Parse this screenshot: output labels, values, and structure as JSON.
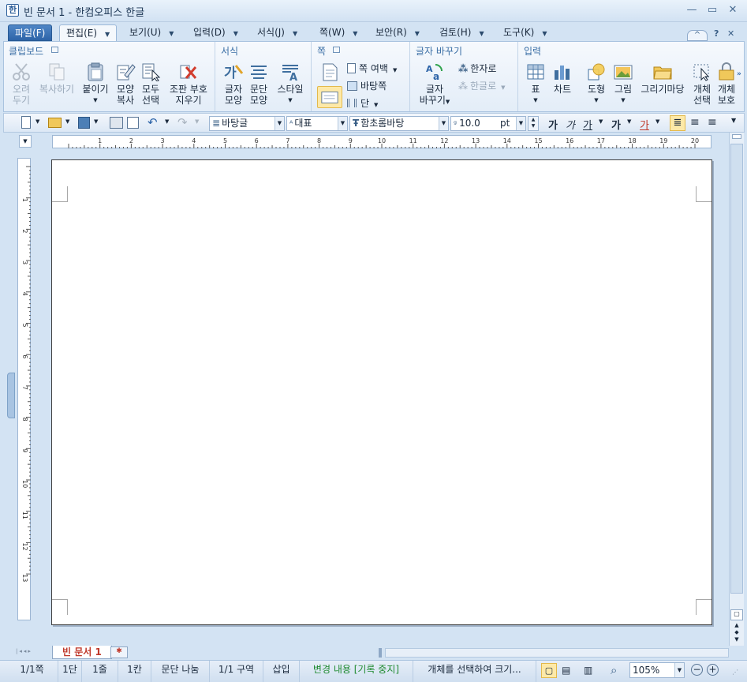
{
  "window": {
    "title": "빈 문서 1 - 한컴오피스 한글",
    "minimize": "—",
    "maximize": "▭",
    "close": "✕"
  },
  "menubar": {
    "items": [
      {
        "label": "파일(F)"
      },
      {
        "label": "편집(E)"
      },
      {
        "label": "보기(U)"
      },
      {
        "label": "입력(D)"
      },
      {
        "label": "서식(J)"
      },
      {
        "label": "쪽(W)"
      },
      {
        "label": "보안(R)"
      },
      {
        "label": "검토(H)"
      },
      {
        "label": "도구(K)"
      }
    ],
    "help": "?",
    "ribbon_toggle": "^"
  },
  "ribbon": {
    "groups": {
      "clipboard": "클립보드",
      "format": "서식",
      "page": "쪽",
      "convert": "글자 바꾸기",
      "insert": "입력"
    },
    "buttons": {
      "cut": [
        "오려",
        "두기"
      ],
      "copy": "복사하기",
      "paste": "붙이기",
      "format_copy": [
        "모양",
        "복사"
      ],
      "select_all": [
        "모두",
        "선택"
      ],
      "clear_codes": [
        "조판 부호",
        "지우기"
      ],
      "char_shape": [
        "글자",
        "모양"
      ],
      "para_shape": [
        "문단",
        "모양"
      ],
      "style": "스타일",
      "page_margin": "쪽 여백",
      "page_bg": "바탕쪽",
      "columns": "단",
      "char_convert": [
        "글자",
        "바꾸기"
      ],
      "to_hanja": "한자로",
      "to_hangul": "한글로",
      "table": "표",
      "chart": "차트",
      "shape": "도형",
      "picture": "그림",
      "drawing_gallery": "그리기마당",
      "obj_select": [
        "개체",
        "선택"
      ],
      "obj_protect": [
        "개체",
        "보호"
      ]
    }
  },
  "toolbar": {
    "style_combo": "바탕글",
    "lang_combo": "대표",
    "font_combo": "함초롬바탕",
    "size_value": "10.0",
    "size_unit": "pt",
    "bold": "가",
    "italic": "가",
    "underline": "가",
    "strike": "가",
    "font_color": "가"
  },
  "ruler": {
    "h_ticks": [
      "1",
      "2",
      "3",
      "4",
      "5",
      "6",
      "7",
      "8",
      "9",
      "10",
      "11",
      "12",
      "13",
      "14",
      "15",
      "16",
      "17",
      "18",
      "19",
      "20"
    ],
    "v_ticks": [
      "1",
      "2",
      "3",
      "4",
      "5",
      "6",
      "7",
      "8",
      "9",
      "10",
      "11",
      "12",
      "13"
    ]
  },
  "tabs": {
    "doc": "빈 문서 1"
  },
  "statusbar": {
    "page": "1/1쪽",
    "column": "1단",
    "line": "1줄",
    "char": "1칸",
    "para_break": "문단 나눔",
    "section": "1/1 구역",
    "insert": "삽입",
    "track": "변경 내용 [기록 중지]",
    "hint": "개체를 선택하여 크기...",
    "zoom": "105%"
  },
  "colors": {
    "accent": "#2d64a8",
    "track_text": "#1e8a2f",
    "doc_tab": "#c0392b"
  }
}
